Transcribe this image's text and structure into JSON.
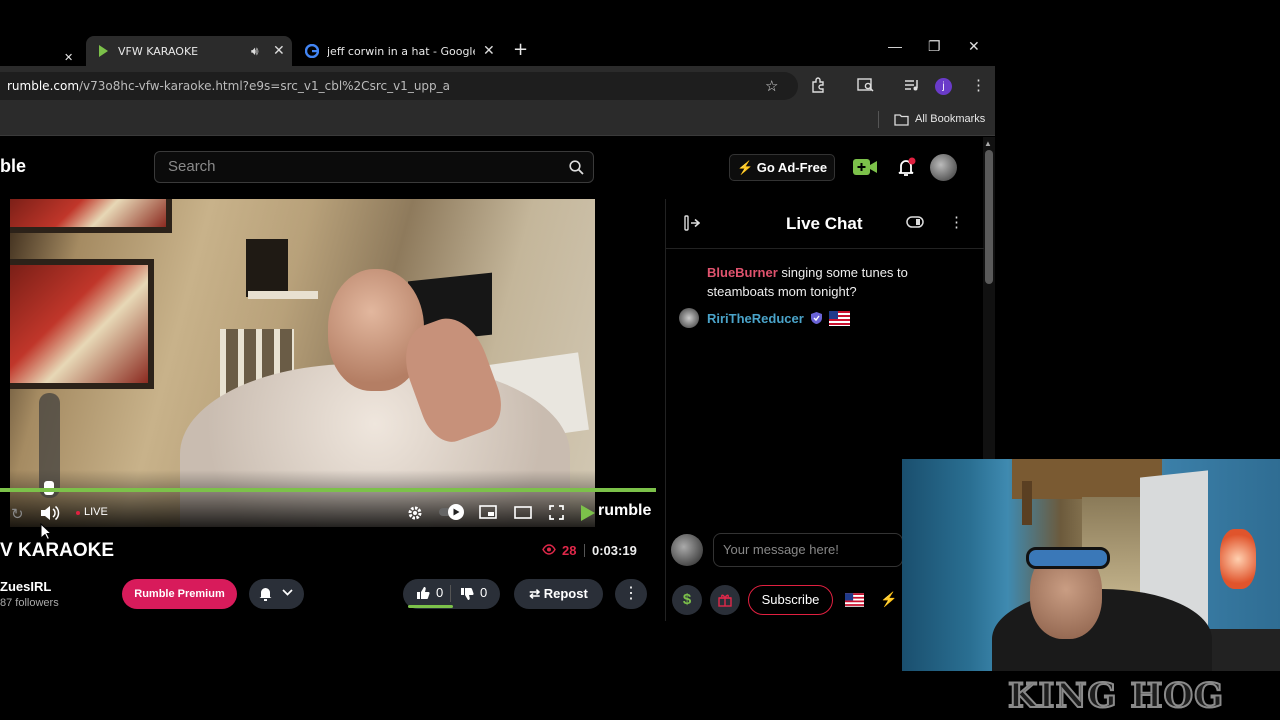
{
  "browser": {
    "tabs": [
      {
        "title": "VFW KARAOKE",
        "active": true,
        "audio": true
      },
      {
        "title": "jeff corwin in a hat - Google Se",
        "active": false,
        "audio": false
      }
    ],
    "new_tab": "+",
    "url_domain": "rumble.com",
    "url_path": "/v73o8hc-vfw-karaoke.html?e9s=src_v1_cbl%2Csrc_v1_upp_a",
    "bookmarks_label": "All Bookmarks",
    "profile_initial": "j"
  },
  "header": {
    "logo_text": "ble",
    "search_placeholder": "Search",
    "go_ad_free": "Go Ad-Free"
  },
  "player": {
    "live_label": "LIVE",
    "watermark": "rumble",
    "progress_fraction": 1.0,
    "volume_fraction": 0.0
  },
  "video": {
    "title": "V KARAOKE",
    "channel": "ZuesIRL",
    "followers": "87 followers",
    "premium_label": "Rumble Premium",
    "likes": "0",
    "dislikes": "0",
    "repost_label": "Repost",
    "viewers": "28",
    "duration": "0:03:19"
  },
  "chat": {
    "title": "Live Chat",
    "messages": [
      {
        "author": "BlueBurner",
        "author_color": "#e0536e",
        "text": "singing some tunes to steamboats mom tonight?"
      },
      {
        "author": "RiriTheReducer",
        "author_color": "#4aa3c9",
        "text": ""
      }
    ],
    "input_placeholder": "Your message here!",
    "subscribe_label": "Subscribe"
  },
  "overlay": {
    "watermark_text": "KING HOG"
  },
  "colors": {
    "accent_green": "#7cc14a",
    "accent_red": "#e02040",
    "premium_pink": "#d81b5b"
  }
}
